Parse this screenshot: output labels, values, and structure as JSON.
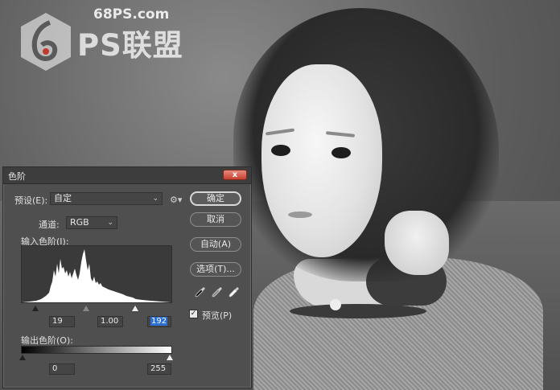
{
  "watermark": {
    "url": "68PS.com",
    "brand": "PS联盟"
  },
  "dialog": {
    "title": "色阶",
    "close_glyph": "x",
    "preset_label": "预设(E):",
    "preset_value": "自定",
    "channel_label": "通道:",
    "channel_value": "RGB",
    "input_levels_label": "输入色阶(I):",
    "input_black": "19",
    "input_gamma": "1.00",
    "input_white": "192",
    "output_levels_label": "输出色阶(O):",
    "output_black": "0",
    "output_white": "255",
    "buttons": {
      "ok": "确定",
      "cancel": "取消",
      "auto": "自动(A)",
      "options": "选项(T)..."
    },
    "preview_label": "预览(P)",
    "preview_checked": true,
    "eyedroppers": [
      "black-eyedropper-icon",
      "gray-eyedropper-icon",
      "white-eyedropper-icon"
    ]
  },
  "colors": {
    "dialog_bg": "#4f4f4f",
    "selection": "#2a6fd6",
    "close_red": "#c8402f"
  }
}
